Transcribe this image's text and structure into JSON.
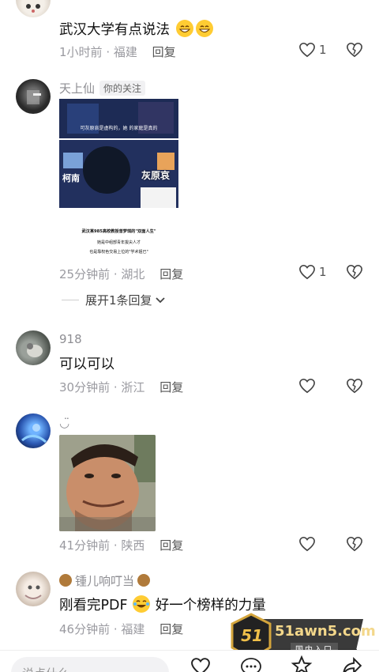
{
  "comments": [
    {
      "text": "武汉大学有点说法",
      "time": "1小时前",
      "location": "福建",
      "reply_label": "回复",
      "likes": "1"
    },
    {
      "username": "天上仙",
      "tag": "你的关注",
      "image_text": {
        "panel1_line": "可灰原哀是虚构的，她  的家庭是真的",
        "name_left": "柯南",
        "name_right": "灰原哀",
        "line1": "武汉某985高校教授曾梦琪的\"双面人生\"",
        "line2": "她是中组部青年拔尖人才",
        "line3": "也是靠权色交易上位的\"学术姐已\""
      },
      "time": "25分钟前",
      "location": "湖北",
      "reply_label": "回复",
      "likes": "1",
      "expand_label": "展开1条回复"
    },
    {
      "username": "918",
      "text": "可以可以",
      "time": "30分钟前",
      "location": "浙江",
      "reply_label": "回复"
    },
    {
      "username": "◡̈",
      "time": "41分钟前",
      "location": "陕西",
      "reply_label": "回复"
    },
    {
      "username": "锺儿响叮当",
      "text_a": "刚看完PDF",
      "text_b": "好一个榜样的力量",
      "time": "46分钟前",
      "location": "福建",
      "reply_label": "回复"
    }
  ],
  "bottom": {
    "input_placeholder": "说点什么"
  },
  "watermark": {
    "logo": "51",
    "site": "51awn5.com",
    "sub": "国内入口"
  },
  "colors": {
    "accent_red": "#e8341c",
    "gold": "#d4a53c"
  }
}
